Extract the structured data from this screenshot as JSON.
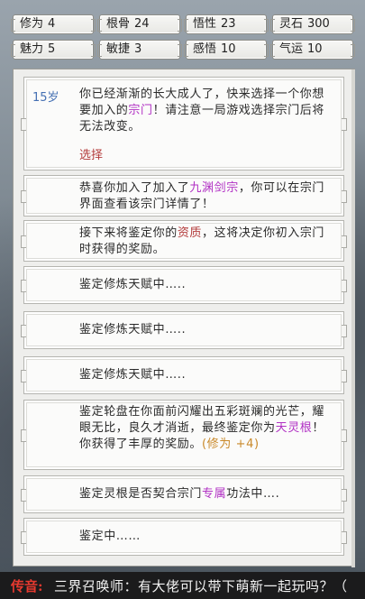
{
  "stats": [
    {
      "label": "修为",
      "value": "4"
    },
    {
      "label": "根骨",
      "value": "24"
    },
    {
      "label": "悟性",
      "value": "23"
    },
    {
      "label": "灵石",
      "value": "300"
    },
    {
      "label": "魅力",
      "value": "5"
    },
    {
      "label": "敏捷",
      "value": "3"
    },
    {
      "label": "感悟",
      "value": "10"
    },
    {
      "label": "气运",
      "value": "10"
    }
  ],
  "log": {
    "age": "15岁",
    "e1_a": "你已经渐渐的长大成人了，快来选择一个你想要加入的",
    "e1_sect": "宗门",
    "e1_b": "！请注意一局游戏选择宗门后将无法改变。",
    "choose": "选择",
    "e2_a": "恭喜你加入了加入了",
    "e2_sect": "九渊剑宗",
    "e2_b": "，你可以在宗门界面查看该宗门详情了！",
    "e3_a": "接下来将鉴定你的",
    "e3_hl": "资质",
    "e3_b": "，这将决定你初入宗门时获得的奖励。",
    "e4": "鉴定修炼天赋中…..",
    "e5": "鉴定修炼天赋中…..",
    "e6": "鉴定修炼天赋中…..",
    "e7_a": "鉴定轮盘在你面前闪耀出五彩斑斓的光芒，耀眼无比，良久才消逝，最终鉴定你为",
    "e7_hl": "天灵根",
    "e7_b": "！你获得了丰厚的奖励。",
    "e7_bonus": "(修为 +4)",
    "e8_a": "鉴定灵根是否契合宗门",
    "e8_hl": "专属",
    "e8_b": "功法中….",
    "e9": "鉴定中……"
  },
  "broadcast": {
    "tag": "传音:",
    "message": "三界召唤师：有大佬可以带下萌新一起玩吗？（"
  }
}
